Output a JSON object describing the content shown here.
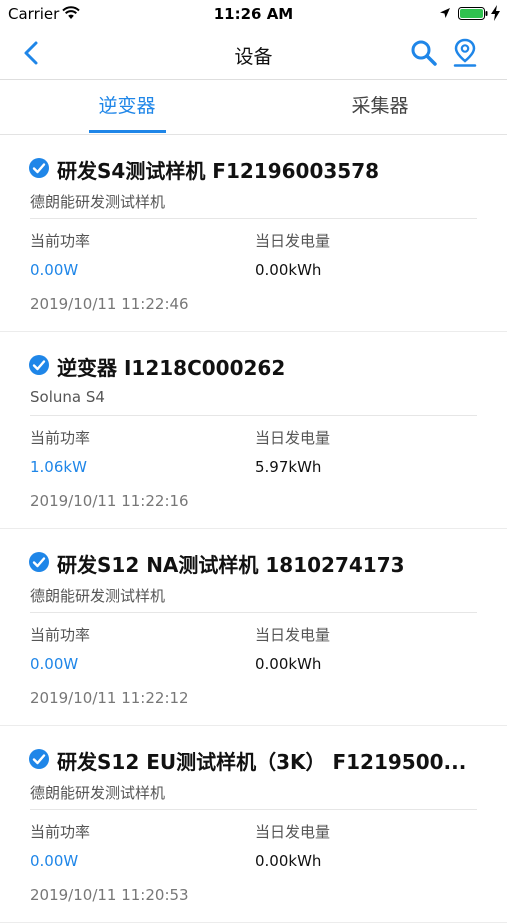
{
  "status_bar": {
    "carrier": "Carrier",
    "time": "11:26 AM"
  },
  "nav": {
    "title": "设备",
    "back_icon": "chevron-left-icon",
    "search_icon": "search-icon",
    "map_icon": "map-pin-icon"
  },
  "tabs": [
    {
      "label": "逆变器",
      "active": true
    },
    {
      "label": "采集器",
      "active": false
    }
  ],
  "labels": {
    "current_power": "当前功率",
    "daily_energy": "当日发电量"
  },
  "colors": {
    "accent": "#1f86e8"
  },
  "devices": [
    {
      "name": "研发S4测试样机 F12196003578",
      "subtitle": "德朗能研发测试样机",
      "power": "0.00W",
      "energy": "0.00kWh",
      "timestamp": "2019/10/11 11:22:46"
    },
    {
      "name": "逆变器 I1218C000262",
      "subtitle": "Soluna S4",
      "power": "1.06kW",
      "energy": "5.97kWh",
      "timestamp": "2019/10/11 11:22:16"
    },
    {
      "name": "研发S12 NA测试样机 1810274173",
      "subtitle": "德朗能研发测试样机",
      "power": "0.00W",
      "energy": "0.00kWh",
      "timestamp": "2019/10/11 11:22:12"
    },
    {
      "name": "研发S12 EU测试样机（3K） F1219500...",
      "subtitle": "德朗能研发测试样机",
      "power": "0.00W",
      "energy": "0.00kWh",
      "timestamp": "2019/10/11 11:20:53"
    }
  ]
}
